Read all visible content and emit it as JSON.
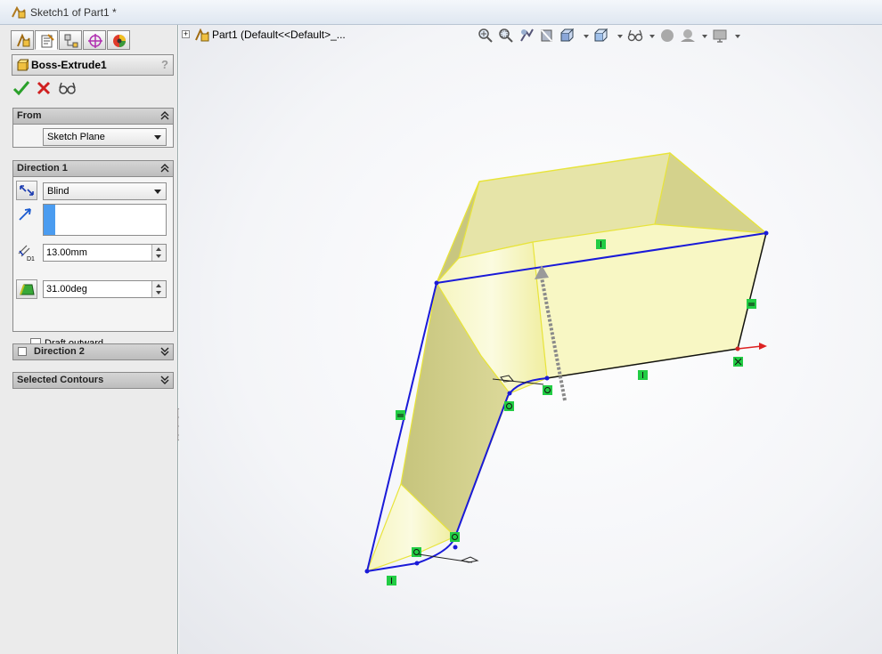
{
  "window": {
    "title": "Sketch1 of Part1 *"
  },
  "feature_manager_tabs": [
    "feature-manager-tab",
    "property-manager-tab",
    "configuration-manager-tab",
    "dimxpert-manager-tab",
    "display-manager-tab"
  ],
  "property_manager": {
    "title": "Boss-Extrude1",
    "help": "?",
    "from": {
      "label": "From",
      "start_condition": "Sketch Plane"
    },
    "direction1": {
      "label": "Direction 1",
      "end_condition": "Blind",
      "depth": "13.00mm",
      "draft_angle": "31.00deg",
      "draft_outward_label": "Draft outward",
      "draft_outward_checked": false
    },
    "direction2": {
      "label": "Direction 2",
      "checked": false
    },
    "selected_contours": {
      "label": "Selected Contours"
    }
  },
  "tree": {
    "root_label": "Part1  (Default<<Default>_..."
  },
  "colors": {
    "sketch_line": "#1a1ad8",
    "face_fill": "#f3f2a6",
    "face_edge": "#e8e43a",
    "relation_badge": "#22cc44",
    "selection_blue": "#4b9cf0"
  }
}
